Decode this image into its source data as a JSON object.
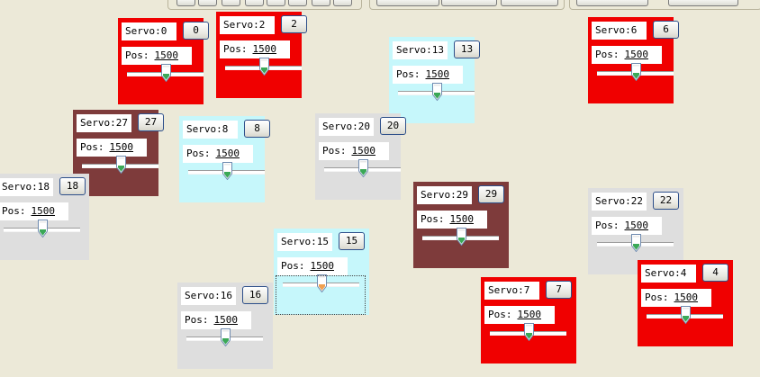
{
  "labels": {
    "servo_prefix": "Servo:",
    "pos_prefix": "Pos:"
  },
  "colors": {
    "red": "#f00000",
    "maroon": "#7e3b3b",
    "cyan": "#c6f7fb",
    "gray": "#dedede",
    "thumb_green": "#3aa857",
    "thumb_orange": "#f0a050"
  },
  "servos": [
    {
      "id": 0,
      "name": "Servo:0",
      "button": "0",
      "pos": "1500",
      "color": "red"
    },
    {
      "id": 2,
      "name": "Servo:2",
      "button": "2",
      "pos": "1500",
      "color": "red"
    },
    {
      "id": 13,
      "name": "Servo:13",
      "button": "13",
      "pos": "1500",
      "color": "cyan"
    },
    {
      "id": 6,
      "name": "Servo:6",
      "button": "6",
      "pos": "1500",
      "color": "red"
    },
    {
      "id": 27,
      "name": "Servo:27",
      "button": "27",
      "pos": "1500",
      "color": "maroon"
    },
    {
      "id": 8,
      "name": "Servo:8",
      "button": "8",
      "pos": "1500",
      "color": "cyan"
    },
    {
      "id": 20,
      "name": "Servo:20",
      "button": "20",
      "pos": "1500",
      "color": "gray"
    },
    {
      "id": 18,
      "name": "Servo:18",
      "button": "18",
      "pos": "1500",
      "color": "gray"
    },
    {
      "id": 29,
      "name": "Servo:29",
      "button": "29",
      "pos": "1500",
      "color": "maroon"
    },
    {
      "id": 22,
      "name": "Servo:22",
      "button": "22",
      "pos": "1500",
      "color": "gray"
    },
    {
      "id": 15,
      "name": "Servo:15",
      "button": "15",
      "pos": "1500",
      "color": "cyan",
      "selected": true
    },
    {
      "id": 16,
      "name": "Servo:16",
      "button": "16",
      "pos": "1500",
      "color": "gray"
    },
    {
      "id": 7,
      "name": "Servo:7",
      "button": "7",
      "pos": "1500",
      "color": "red"
    },
    {
      "id": 4,
      "name": "Servo:4",
      "button": "4",
      "pos": "1500",
      "color": "red"
    }
  ]
}
